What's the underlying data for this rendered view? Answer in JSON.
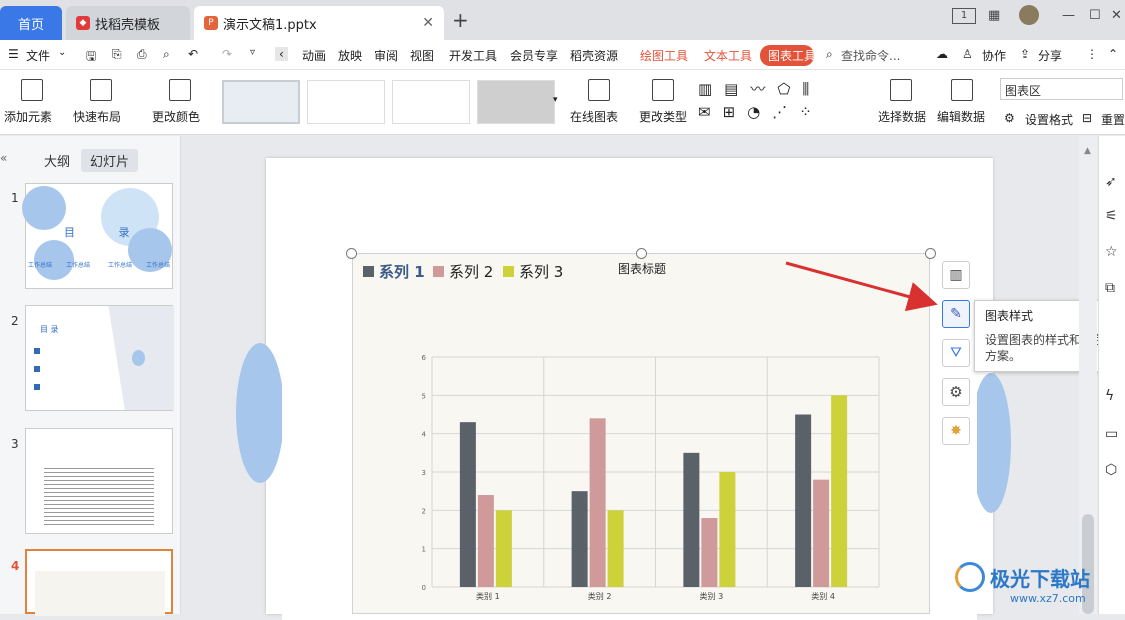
{
  "tabs": {
    "home": "首页",
    "docer": "找稻壳模板",
    "doc": "演示文稿1.pptx"
  },
  "menu": {
    "file": "文件",
    "items": [
      "动画",
      "放映",
      "审阅",
      "视图",
      "开发工具",
      "会员专享",
      "稻壳资源"
    ],
    "drawing": "绘图工具",
    "text": "文本工具",
    "chart": "图表工具",
    "search": "查找命令...",
    "collab": "协作",
    "share": "分享"
  },
  "toolbar": {
    "add_element": "添加元素",
    "quick_layout": "快速布局",
    "change_color": "更改颜色",
    "online_chart": "在线图表",
    "change_type": "更改类型",
    "select_data": "选择数据",
    "edit_data": "编辑数据",
    "area_select": "图表区",
    "set_format": "设置格式",
    "reset": "重置"
  },
  "outline": {
    "outline": "大纲",
    "slides": "幻灯片"
  },
  "slide_numbers": [
    "1",
    "2",
    "3",
    "4"
  ],
  "thumb1": {
    "title": "目 录",
    "items": [
      "工作总结",
      "工作总结",
      "工作总结",
      "工作总结"
    ]
  },
  "thumb2": {
    "title": "目 录"
  },
  "tooltip": {
    "title": "图表样式",
    "desc": "设置图表的样式和配色方案。"
  },
  "colors": {
    "accent": "#3a78e8",
    "chart_tab": "#e2533a",
    "series1": "#5b6169",
    "series2": "#d09a9a",
    "series3": "#cdd13a"
  },
  "chart_data": {
    "type": "bar",
    "title": "图表标题",
    "categories": [
      "类别 1",
      "类别 2",
      "类别 3",
      "类别 4"
    ],
    "series": [
      {
        "name": "系列 1",
        "values": [
          4.3,
          2.5,
          3.5,
          4.5
        ]
      },
      {
        "name": "系列 2",
        "values": [
          2.4,
          4.4,
          1.8,
          2.8
        ]
      },
      {
        "name": "系列 3",
        "values": [
          2,
          2,
          3,
          5
        ]
      }
    ],
    "ylim": [
      0,
      6
    ],
    "yticks": [
      "0",
      "1",
      "2",
      "3",
      "4",
      "5",
      "6"
    ],
    "grid": true,
    "legend": "top-left"
  },
  "watermark": {
    "name": "极光下载站",
    "url": "www.xz7.com"
  }
}
